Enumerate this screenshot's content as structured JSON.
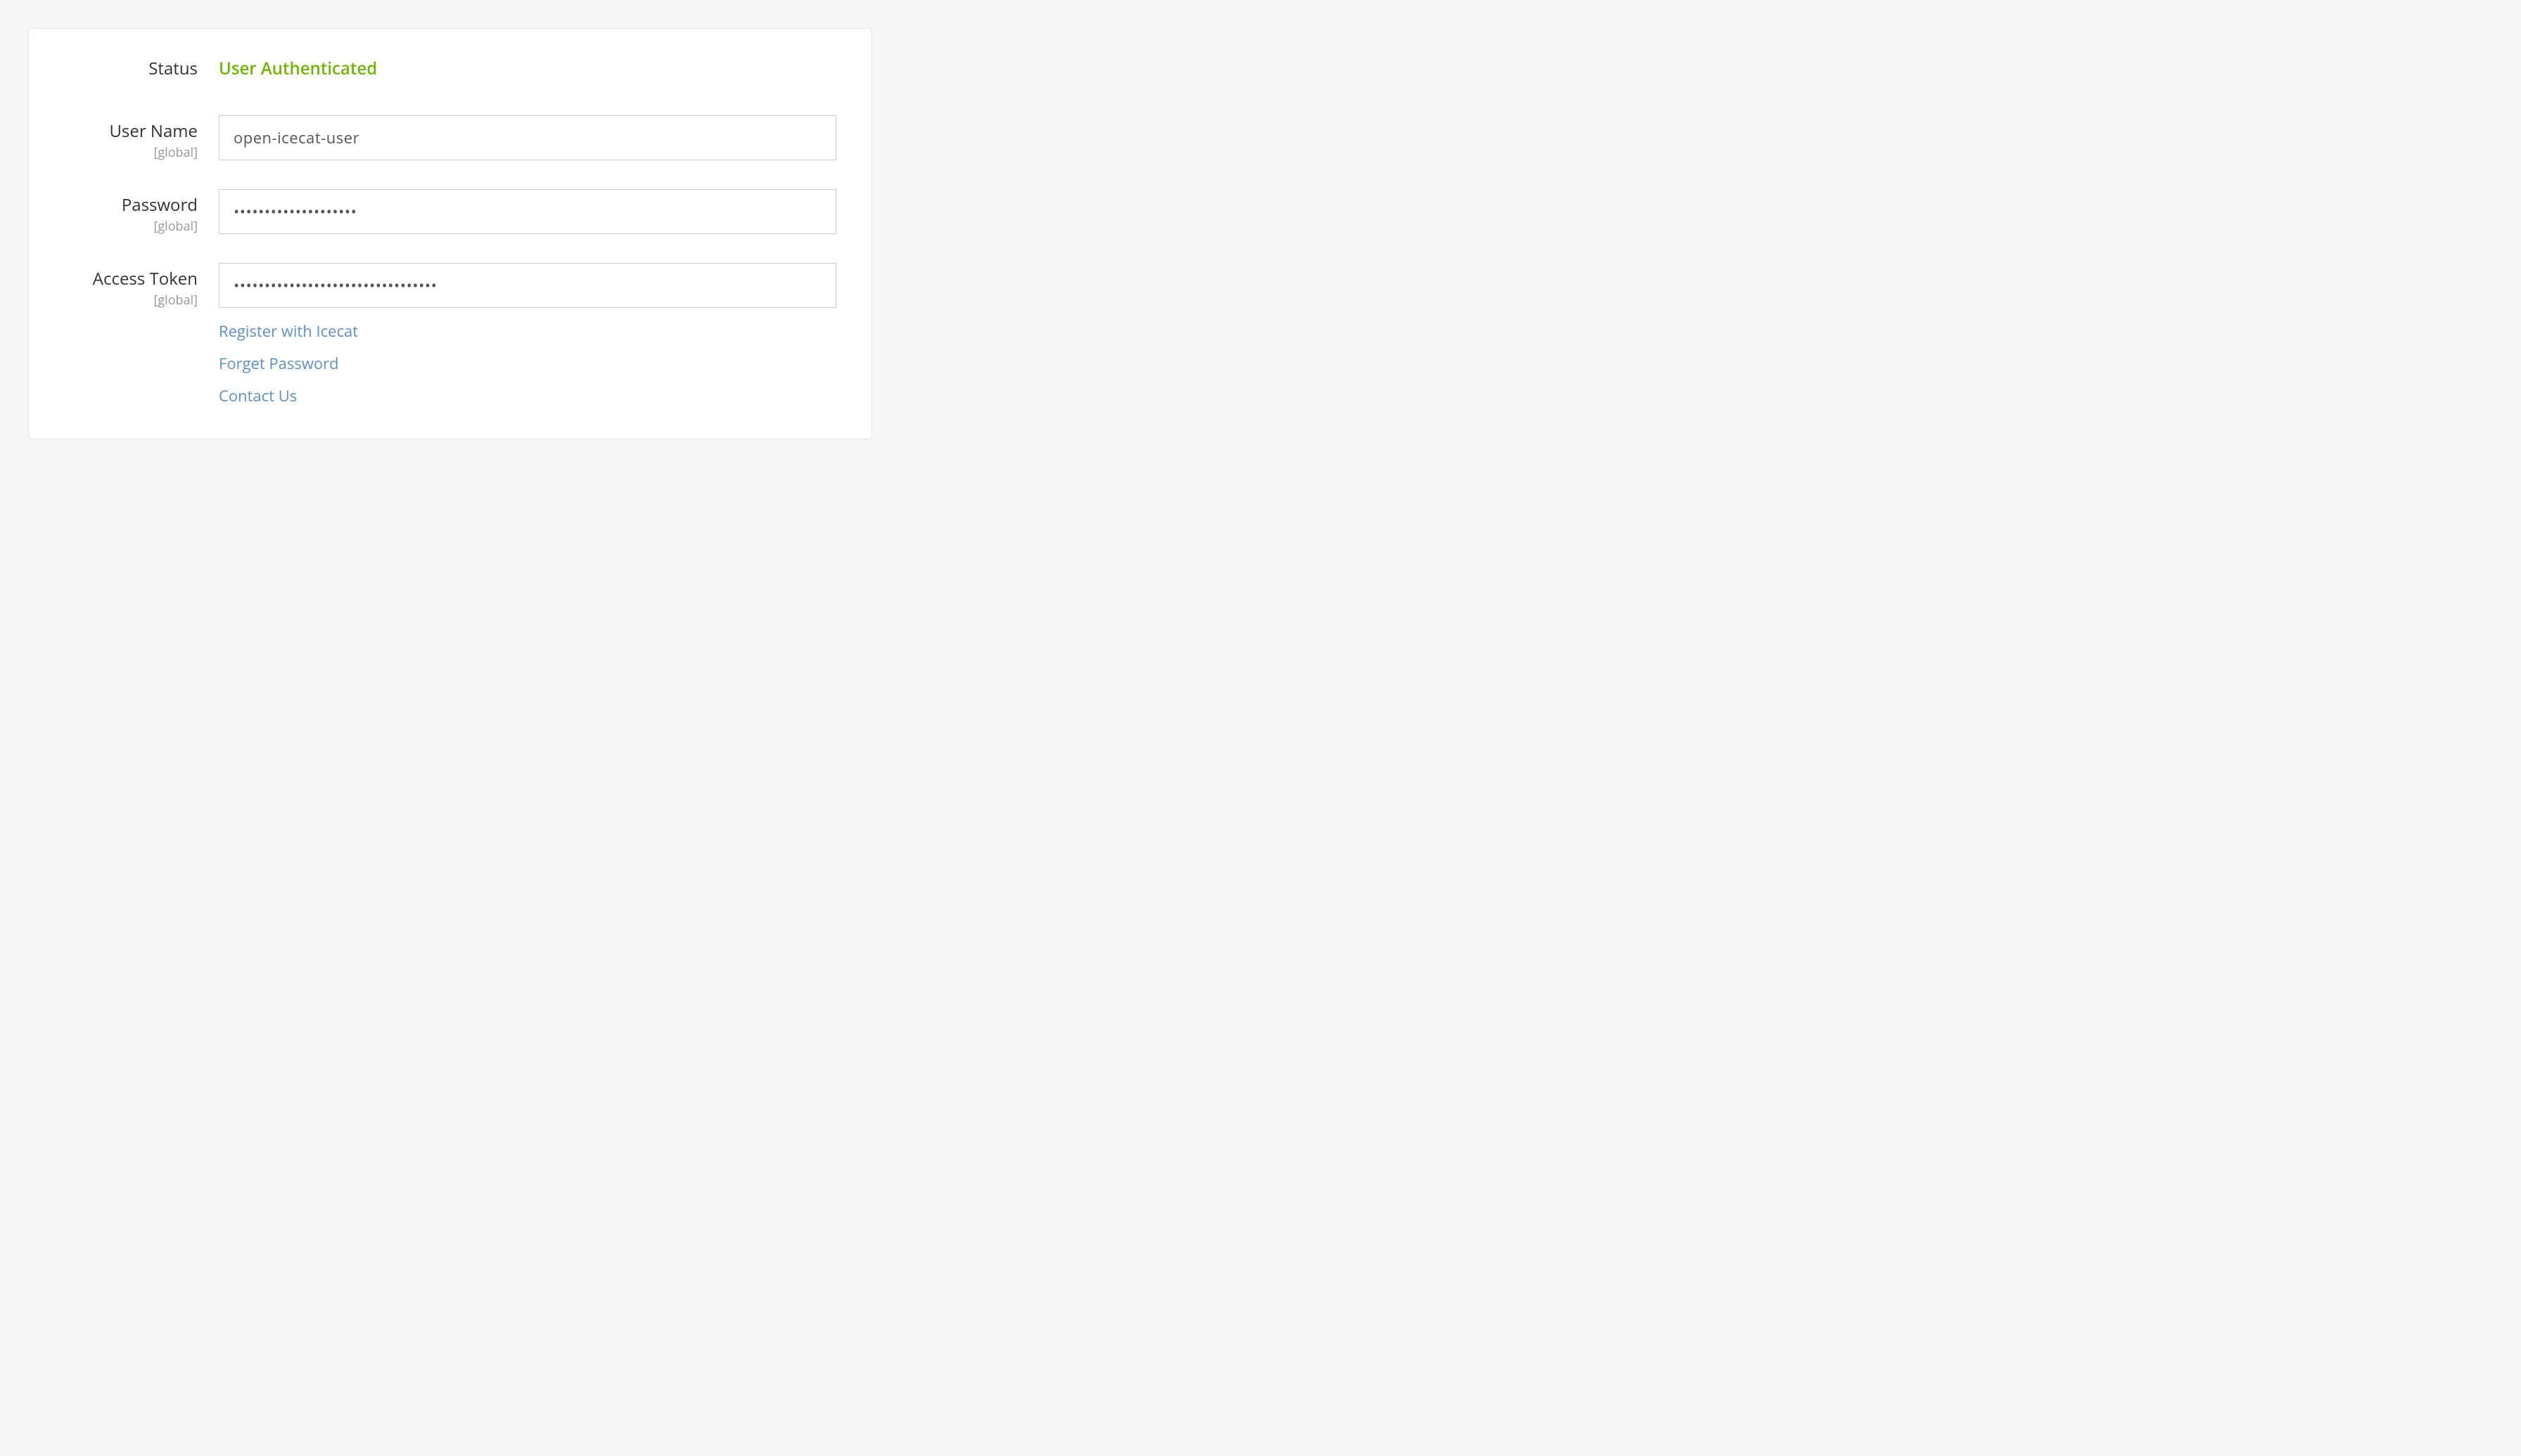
{
  "status": {
    "label": "Status",
    "value": "User Authenticated"
  },
  "username": {
    "label": "User Name",
    "scope": "[global]",
    "value": "open-icecat-user"
  },
  "password": {
    "label": "Password",
    "scope": "[global]",
    "value": "••••••••••••••••••••"
  },
  "accessToken": {
    "label": "Access Token",
    "scope": "[global]",
    "value": "•••••••••••••••••••••••••••••••••"
  },
  "links": {
    "register": "Register with Icecat",
    "forgetPassword": "Forget Password",
    "contactUs": "Contact Us"
  }
}
